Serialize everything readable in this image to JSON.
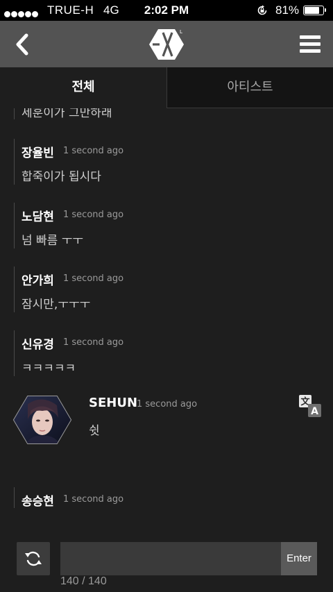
{
  "status_bar": {
    "carrier": "TRUE-H",
    "network": "4G",
    "time": "2:02 PM",
    "battery": "81%",
    "battery_level": 0.81,
    "signal_dots": 5
  },
  "header": {
    "back_icon": "chevron-left-icon",
    "logo_icon": "exo-l-hexagon-logo",
    "menu_icon": "hamburger-menu-icon"
  },
  "tabs": [
    {
      "label": "전체",
      "active": true
    },
    {
      "label": "아티스트",
      "active": false
    }
  ],
  "feed": {
    "cutoff_text": "세훈이가 그만하래",
    "messages": [
      {
        "name": "장율빈",
        "time": "1 second ago",
        "text": "합죽이가 됩시다"
      },
      {
        "name": "노담현",
        "time": "1 second ago",
        "text": "넘 빠름 ㅜㅜ"
      },
      {
        "name": "안가희",
        "time": "1 second ago",
        "text": "잠시만,ㅜㅜㅜ"
      },
      {
        "name": "신유경",
        "time": "1 second ago",
        "text": "ㅋㅋㅋㅋㅋ"
      }
    ],
    "artist_message": {
      "name": "SEHUN",
      "time": "1 second ago",
      "text": "쉿",
      "avatar_icon": "artist-hexagon-avatar",
      "translate_icon": "translate-icon"
    },
    "last_message": {
      "name": "송승현",
      "time": "1 second ago"
    }
  },
  "input_bar": {
    "refresh_icon": "refresh-icon",
    "placeholder": "",
    "enter_label": "Enter",
    "counter": "140 / 140"
  },
  "colors": {
    "background": "#1e1e1e",
    "header": "#535353",
    "status_bar": "#000000"
  }
}
